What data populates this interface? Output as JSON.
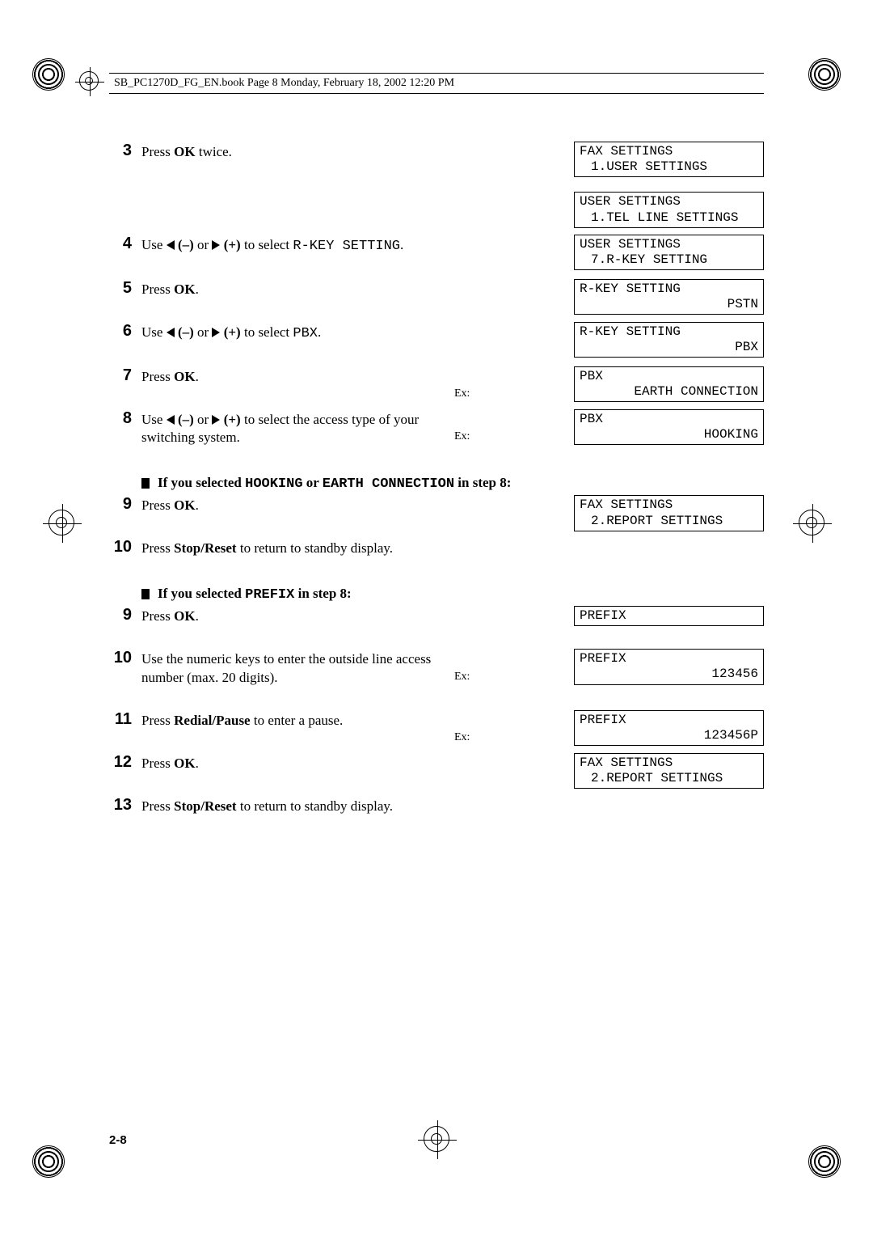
{
  "header": "SB_PC1270D_FG_EN.book  Page 8  Monday, February 18, 2002  12:20 PM",
  "steps": {
    "s3": {
      "num": "3",
      "t1": "Press ",
      "b1": "OK",
      "t2": " twice."
    },
    "s4": {
      "num": "4",
      "t1": "Use ",
      "b1": "(–)",
      "t2": " or ",
      "b2": "(+)",
      "t3": " to select ",
      "m1": "R-KEY SETTING",
      "t4": "."
    },
    "s5": {
      "num": "5",
      "t1": "Press ",
      "b1": "OK",
      "t2": "."
    },
    "s6": {
      "num": "6",
      "t1": "Use ",
      "b1": "(–)",
      "t2": " or ",
      "b2": "(+)",
      "t3": " to select ",
      "m1": "PBX",
      "t4": "."
    },
    "s7": {
      "num": "7",
      "t1": "Press ",
      "b1": "OK",
      "t2": "."
    },
    "s8": {
      "num": "8",
      "t1": "Use ",
      "b1": "(–)",
      "t2": " or ",
      "b2": "(+)",
      "t3": " to select the access type of your switching system."
    },
    "sub1": {
      "pre": "If you selected ",
      "m1": "HOOKING",
      "mid": " or ",
      "m2": "EARTH CONNECTION",
      "post": " in step 8:"
    },
    "s9a": {
      "num": "9",
      "t1": "Press ",
      "b1": "OK",
      "t2": "."
    },
    "s10a": {
      "num": "10",
      "t1": "Press ",
      "b1": "Stop/Reset",
      "t2": " to return to standby display."
    },
    "sub2": {
      "pre": "If you selected ",
      "m1": "PREFIX",
      "post": " in step 8:"
    },
    "s9b": {
      "num": "9",
      "t1": "Press ",
      "b1": "OK",
      "t2": "."
    },
    "s10b": {
      "num": "10",
      "t1": "Use the numeric keys to enter the outside line access number (max. 20 digits)."
    },
    "s11": {
      "num": "11",
      "t1": "Press ",
      "b1": "Redial/Pause",
      "t2": " to enter a pause."
    },
    "s12": {
      "num": "12",
      "t1": "Press ",
      "b1": "OK",
      "t2": "."
    },
    "s13": {
      "num": "13",
      "t1": "Press ",
      "b1": "Stop/Reset",
      "t2": " to return to standby display."
    }
  },
  "lcds": {
    "d1": {
      "l1": "FAX SETTINGS",
      "l2": "1.USER SETTINGS"
    },
    "d2": {
      "l1": "USER SETTINGS",
      "l2": "1.TEL LINE SETTINGS"
    },
    "d3": {
      "l1": "USER SETTINGS",
      "l2": "7.R-KEY SETTING"
    },
    "d4": {
      "l1": "R-KEY SETTING",
      "l2": "PSTN"
    },
    "d5": {
      "l1": "R-KEY SETTING",
      "l2": "PBX"
    },
    "d6": {
      "l1": "PBX",
      "l2": "EARTH CONNECTION",
      "ex": "Ex:"
    },
    "d7": {
      "l1": "PBX",
      "l2": "HOOKING",
      "ex": "Ex:"
    },
    "d8": {
      "l1": "FAX SETTINGS",
      "l2": "2.REPORT SETTINGS"
    },
    "d9": {
      "l1": "PREFIX",
      "l2": " "
    },
    "d10": {
      "l1": "PREFIX",
      "l2": "123456",
      "ex": "Ex:"
    },
    "d11": {
      "l1": "PREFIX",
      "l2": "123456P",
      "ex": "Ex:"
    },
    "d12": {
      "l1": "FAX SETTINGS",
      "l2": "2.REPORT SETTINGS"
    }
  },
  "pageNumber": "2-8"
}
